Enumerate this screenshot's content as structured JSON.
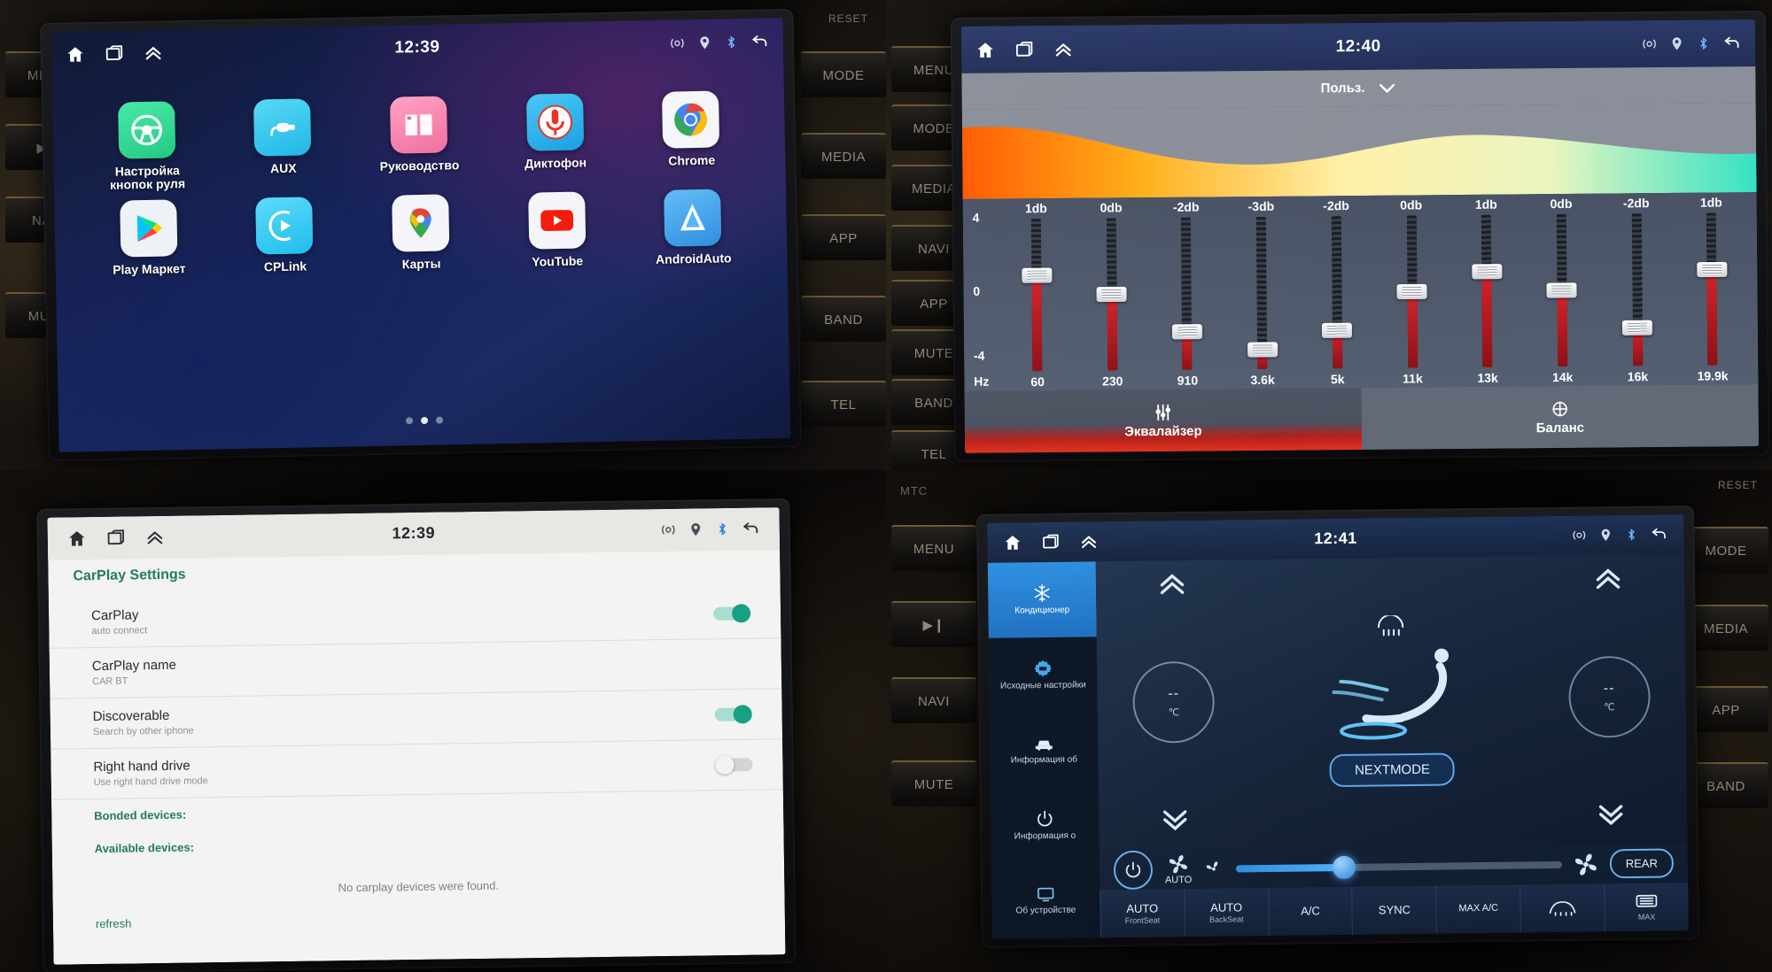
{
  "panels": {
    "top_left": {
      "statusbar": {
        "clock": "12:39",
        "left_icons": [
          "home-icon",
          "recents-icon",
          "chevron-up-icon"
        ],
        "right_icons": [
          "wifi-radar-icon",
          "location-icon",
          "bluetooth-icon",
          "back-icon"
        ]
      },
      "apps": [
        {
          "label": "Настройка кнопок руля",
          "icon": "steering-wheel-icon",
          "color": "#2fdc94"
        },
        {
          "label": "AUX",
          "icon": "aux-plug-icon",
          "color": "#2fc8f0"
        },
        {
          "label": "Руководство",
          "icon": "book-icon",
          "color": "#f88ab4"
        },
        {
          "label": "Диктофон",
          "icon": "microphone-icon",
          "color": "#2fb8f0"
        },
        {
          "label": "Chrome",
          "icon": "chrome-icon",
          "color": "#f2f4f7"
        },
        {
          "label": "Play Маркет",
          "icon": "play-store-icon",
          "color": "#eef1f6"
        },
        {
          "label": "CPLink",
          "icon": "cplink-icon",
          "color": "#35c6f2"
        },
        {
          "label": "Карты",
          "icon": "google-maps-icon",
          "color": "#f3f5f8"
        },
        {
          "label": "YouTube",
          "icon": "youtube-icon",
          "color": "#f3f5f8"
        },
        {
          "label": "AndroidAuto",
          "icon": "android-auto-icon",
          "color": "#45a7ea"
        }
      ],
      "page_dots": {
        "count": 3,
        "active_index": 1
      },
      "hw_buttons": [
        "MENU",
        "▶‖",
        "NAVI",
        "MUTE"
      ]
    },
    "top_right": {
      "statusbar": {
        "clock": "12:40",
        "left_icons": [
          "home-icon",
          "recents-icon",
          "chevron-up-icon"
        ],
        "right_icons": [
          "wifi-radar-icon",
          "location-icon",
          "bluetooth-icon",
          "back-icon"
        ]
      },
      "preset": {
        "label": "Польз.",
        "icon": "chevron-down-icon"
      },
      "axis": {
        "top": "4",
        "mid": "0",
        "bottom": "-4",
        "unit": "Hz"
      },
      "tabs": [
        {
          "label": "Эквалайзер",
          "icon": "sliders-icon",
          "active": true
        },
        {
          "label": "Баланс",
          "icon": "balance-target-icon",
          "active": false
        }
      ],
      "hw_buttons": [
        "MENU",
        "MODE",
        "MEDIA",
        "NAVI",
        "APP",
        "MUTE",
        "BAND",
        "TEL"
      ]
    },
    "bottom_left": {
      "statusbar": {
        "clock": "12:39",
        "left_icons": [
          "home-icon",
          "recents-icon",
          "chevron-up-icon"
        ],
        "right_icons": [
          "wifi-radar-icon",
          "location-icon",
          "bluetooth-icon",
          "back-icon"
        ]
      },
      "title": "CarPlay Settings",
      "rows": [
        {
          "title": "CarPlay",
          "sub": "auto connect",
          "toggle": "on"
        },
        {
          "title": "CarPlay name",
          "sub": "CAR BT",
          "toggle": null
        },
        {
          "title": "Discoverable",
          "sub": "Search by other iphone",
          "toggle": "on"
        },
        {
          "title": "Right hand drive",
          "sub": "Use right hand drive mode",
          "toggle": "off"
        }
      ],
      "sections": [
        "Bonded devices:",
        "Available devices:"
      ],
      "empty_text": "No carplay devices were found.",
      "refresh": "refresh"
    },
    "bottom_right": {
      "statusbar": {
        "clock": "12:41",
        "left_icons": [
          "home-icon",
          "recents-icon",
          "chevron-up-icon"
        ],
        "right_icons": [
          "wifi-radar-icon",
          "location-icon",
          "bluetooth-icon",
          "back-icon"
        ]
      },
      "side_menu": [
        {
          "label": "Кондиционер",
          "icon": "snowflake-icon",
          "active": true
        },
        {
          "label": "Исходные настройки",
          "icon": "gear-car-icon",
          "active": false
        },
        {
          "label": "Информация об",
          "icon": "car-info-icon",
          "active": false
        },
        {
          "label": "Информация о",
          "icon": "power-info-icon",
          "active": false
        },
        {
          "label": "Об устройстве",
          "icon": "device-info-icon",
          "active": false
        }
      ],
      "left_temp": {
        "value": "--",
        "unit": "℃",
        "up": "chevron-up-icon",
        "down": "chevron-down-icon"
      },
      "right_temp": {
        "value": "--",
        "unit": "℃",
        "up": "chevron-up-icon",
        "down": "chevron-down-icon"
      },
      "nextmode": "NEXTMODE",
      "fan": {
        "auto_label": "AUTO",
        "level_percent": 33
      },
      "rear": "REAR",
      "bottom_buttons": [
        {
          "label": "AUTO",
          "sub": "FrontSeat"
        },
        {
          "label": "AUTO",
          "sub": "BackSeat"
        },
        {
          "label": "A/C",
          "sub": ""
        },
        {
          "label": "SYNC",
          "sub": ""
        },
        {
          "label": "MAX A/C",
          "sub": ""
        },
        {
          "label": "",
          "sub": "",
          "icon": "front-defrost-icon"
        },
        {
          "label": "MAX",
          "sub": "",
          "icon": "rear-defrost-icon"
        }
      ],
      "hw_buttons": [
        "MENU",
        "▶‖",
        "NAVI",
        "MUTE"
      ],
      "hw_buttons_right": [
        "MODE",
        "MEDIA",
        "APP",
        "BAND"
      ],
      "labels": {
        "mtc": "MTC",
        "reset": "RESET"
      }
    }
  },
  "eq_data": {
    "type": "bar",
    "title": "Эквалайзер",
    "xlabel": "Hz",
    "ylabel": "db",
    "ylim": [
      -4,
      4
    ],
    "categories": [
      "60",
      "230",
      "910",
      "3.6k",
      "5k",
      "11k",
      "13k",
      "14k",
      "16k",
      "19.9k"
    ],
    "values": [
      1,
      0,
      -2,
      -3,
      -2,
      0,
      1,
      0,
      -2,
      1
    ],
    "value_labels": [
      "1db",
      "0db",
      "-2db",
      "-3db",
      "-2db",
      "0db",
      "1db",
      "0db",
      "-2db",
      "1db"
    ],
    "axis_ticks": [
      "4",
      "0",
      "-4"
    ],
    "grid": false,
    "legend": "none"
  }
}
